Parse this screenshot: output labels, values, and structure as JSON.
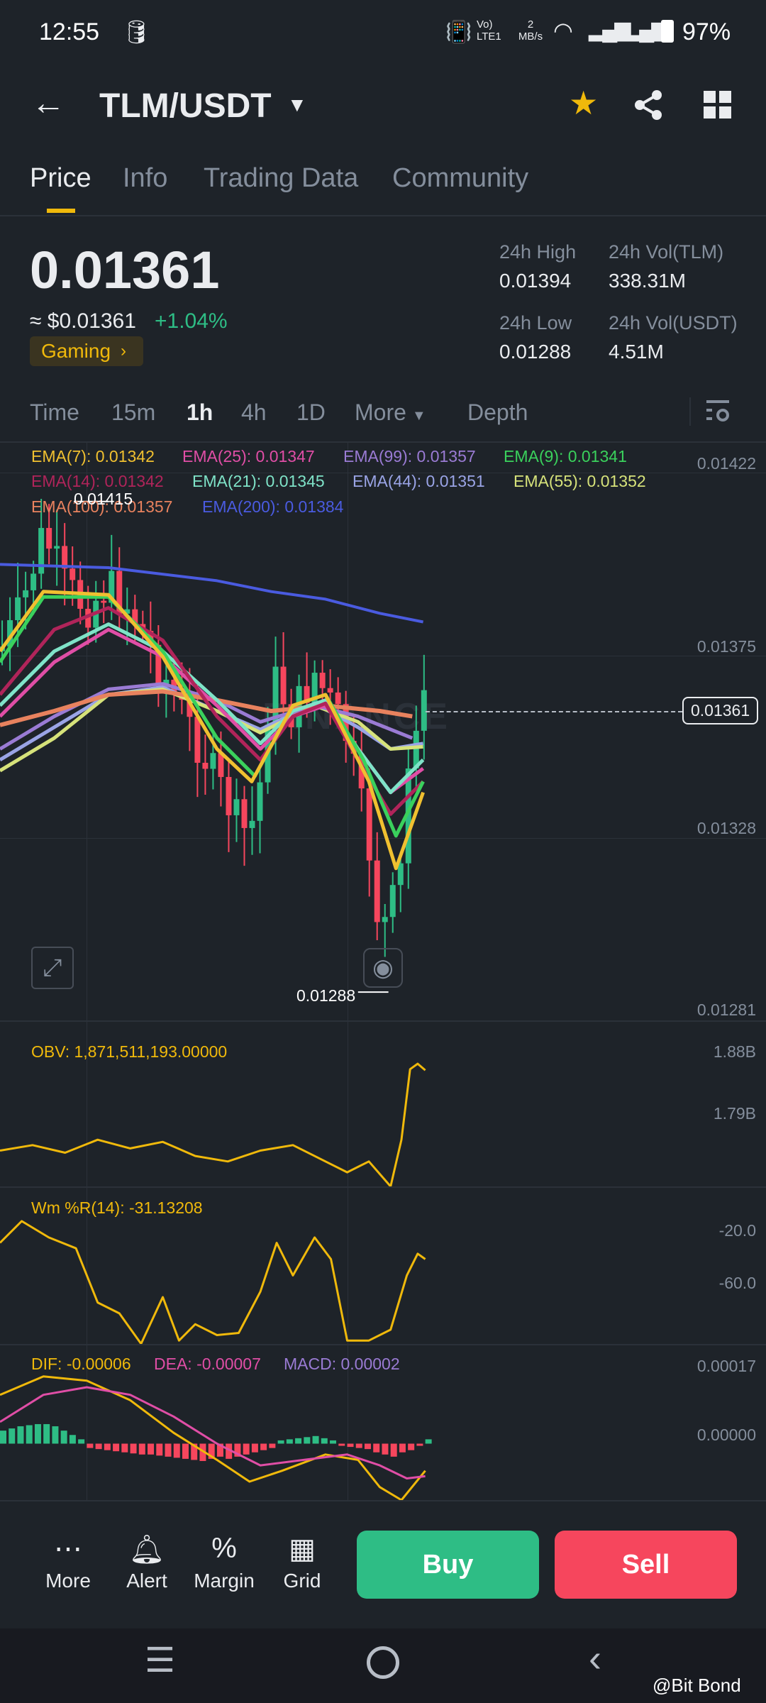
{
  "status_bar": {
    "time": "12:55",
    "net_lte": "Vo) LTE1",
    "speed": "2 MB/s",
    "battery": "97%"
  },
  "header": {
    "pair": "TLM/USDT"
  },
  "tabs": [
    "Price",
    "Info",
    "Trading Data",
    "Community"
  ],
  "price": {
    "last": "0.01361",
    "usd": "≈ $0.01361",
    "change": "+1.04%",
    "tag": "Gaming",
    "high_label": "24h High",
    "high": "0.01394",
    "vol_tlm_label": "24h Vol(TLM)",
    "vol_tlm": "338.31M",
    "low_label": "24h Low",
    "low": "0.01288",
    "vol_usdt_label": "24h Vol(USDT)",
    "vol_usdt": "4.51M"
  },
  "intervals": [
    "Time",
    "15m",
    "1h",
    "4h",
    "1D",
    "More",
    "Depth"
  ],
  "ema_legend": [
    {
      "text": "EMA(7): 0.01342",
      "color": "#f0c030"
    },
    {
      "text": "EMA(25): 0.01347",
      "color": "#e04ea6"
    },
    {
      "text": "EMA(99): 0.01357",
      "color": "#9a7bd4"
    },
    {
      "text": "EMA(9): 0.01341",
      "color": "#3ad15c"
    },
    {
      "text": "EMA(14): 0.01342",
      "color": "#b0245a"
    },
    {
      "text": "EMA(21): 0.01345",
      "color": "#7fe3c8"
    },
    {
      "text": "EMA(44): 0.01351",
      "color": "#9aa4e6"
    },
    {
      "text": "EMA(55): 0.01352",
      "color": "#d6e27a"
    },
    {
      "text": "EMA(100): 0.01357",
      "color": "#e8825e"
    },
    {
      "text": "EMA(200): 0.01384",
      "color": "#4a5be0"
    }
  ],
  "price_axis": [
    "0.01422",
    "0.01375",
    "0.01328",
    "0.01281"
  ],
  "current_price_tag": "0.01361",
  "chart_high": "0.01415",
  "chart_low": "0.01288",
  "watermark": "BINANCE",
  "obv": {
    "label": "OBV: 1,871,511,193.00000",
    "axis": [
      "1.88B",
      "1.79B"
    ]
  },
  "wmr": {
    "label": "Wm %R(14): -31.13208",
    "axis": [
      "-20.0",
      "-60.0"
    ]
  },
  "macd": {
    "dif": "DIF: -0.00006",
    "dea": "DEA: -0.00007",
    "macd": "MACD: 0.00002",
    "axis": [
      "0.00017",
      "0.00000"
    ]
  },
  "bottom": {
    "more": "More",
    "alert": "Alert",
    "margin": "Margin",
    "grid": "Grid",
    "buy": "Buy",
    "sell": "Sell"
  },
  "watermark_credit": "@Bit Bond",
  "colors": {
    "up": "#2ebd85",
    "down": "#f6465d",
    "accent": "#f0b90b"
  }
}
